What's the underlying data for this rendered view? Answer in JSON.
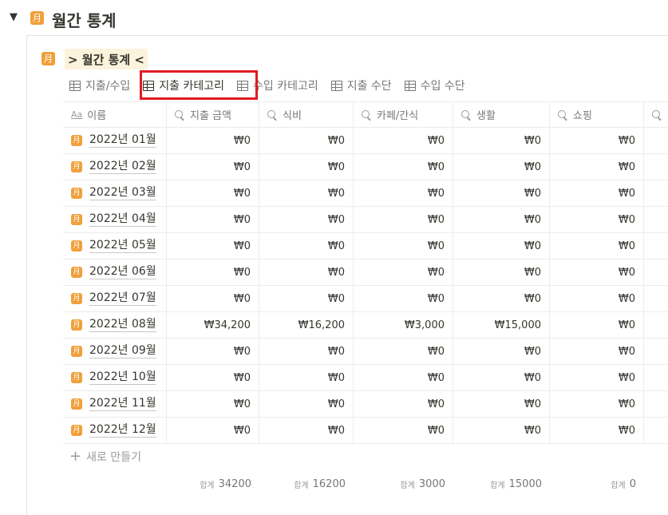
{
  "header": {
    "toggle": "▼",
    "icon_glyph": "月",
    "title": "월간 통계"
  },
  "database": {
    "icon_glyph": "月",
    "title": "> 월간 통계 <"
  },
  "views": [
    {
      "label": "지출/수입"
    },
    {
      "label": "지출 카테고리"
    },
    {
      "label": "수입 카테고리"
    },
    {
      "label": "지출 수단"
    },
    {
      "label": "수입 수단"
    }
  ],
  "columns": [
    {
      "icon": "Aa",
      "label": "이름"
    },
    {
      "icon": "magnifier",
      "label": "지출 금액"
    },
    {
      "icon": "magnifier",
      "label": "식비"
    },
    {
      "icon": "magnifier",
      "label": "카페/간식"
    },
    {
      "icon": "magnifier",
      "label": "생활"
    },
    {
      "icon": "magnifier",
      "label": "쇼핑"
    },
    {
      "icon": "magnifier",
      "label": ""
    }
  ],
  "rows": [
    {
      "name": "2022년 01월",
      "values": [
        "₩0",
        "₩0",
        "₩0",
        "₩0",
        "₩0"
      ]
    },
    {
      "name": "2022년 02월",
      "values": [
        "₩0",
        "₩0",
        "₩0",
        "₩0",
        "₩0"
      ]
    },
    {
      "name": "2022년 03월",
      "values": [
        "₩0",
        "₩0",
        "₩0",
        "₩0",
        "₩0"
      ]
    },
    {
      "name": "2022년 04월",
      "values": [
        "₩0",
        "₩0",
        "₩0",
        "₩0",
        "₩0"
      ]
    },
    {
      "name": "2022년 05월",
      "values": [
        "₩0",
        "₩0",
        "₩0",
        "₩0",
        "₩0"
      ]
    },
    {
      "name": "2022년 06월",
      "values": [
        "₩0",
        "₩0",
        "₩0",
        "₩0",
        "₩0"
      ]
    },
    {
      "name": "2022년 07월",
      "values": [
        "₩0",
        "₩0",
        "₩0",
        "₩0",
        "₩0"
      ]
    },
    {
      "name": "2022년 08월",
      "values": [
        "₩34,200",
        "₩16,200",
        "₩3,000",
        "₩15,000",
        "₩0"
      ]
    },
    {
      "name": "2022년 09월",
      "values": [
        "₩0",
        "₩0",
        "₩0",
        "₩0",
        "₩0"
      ]
    },
    {
      "name": "2022년 10월",
      "values": [
        "₩0",
        "₩0",
        "₩0",
        "₩0",
        "₩0"
      ]
    },
    {
      "name": "2022년 11월",
      "values": [
        "₩0",
        "₩0",
        "₩0",
        "₩0",
        "₩0"
      ]
    },
    {
      "name": "2022년 12월",
      "values": [
        "₩0",
        "₩0",
        "₩0",
        "₩0",
        "₩0"
      ]
    }
  ],
  "new_row_label": "새로 만들기",
  "summary": {
    "label": "합계",
    "values": [
      "34200",
      "16200",
      "3000",
      "15000",
      "0"
    ]
  },
  "colors": {
    "accent_icon": "#f0a03c",
    "highlight_box": "#e11b22",
    "title_bg": "#fbf3db"
  }
}
